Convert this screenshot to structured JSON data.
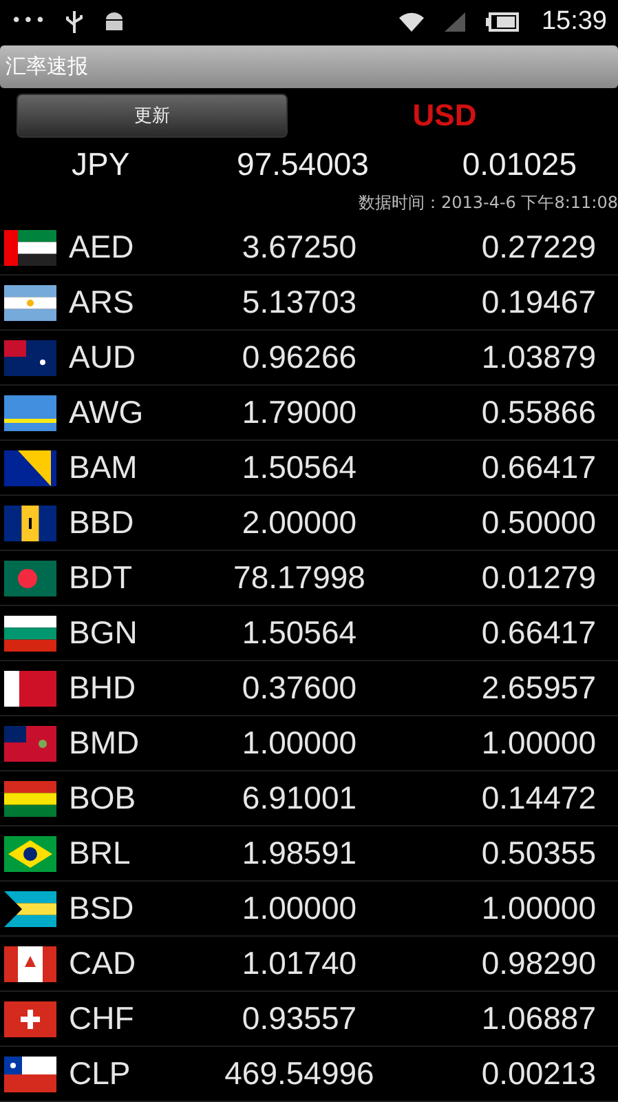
{
  "status_bar": {
    "time": "15:39",
    "notification_dots": "•••"
  },
  "title": "汇率速报",
  "update_button": "更新",
  "base_currency": "USD",
  "featured": {
    "code": "JPY",
    "rate": "97.54003",
    "inverse": "0.01025"
  },
  "data_time": "数据时间：2013-4-6 下午8:11:08",
  "rates": [
    {
      "code": "AED",
      "rate": "3.67250",
      "inverse": "0.27229"
    },
    {
      "code": "ARS",
      "rate": "5.13703",
      "inverse": "0.19467"
    },
    {
      "code": "AUD",
      "rate": "0.96266",
      "inverse": "1.03879"
    },
    {
      "code": "AWG",
      "rate": "1.79000",
      "inverse": "0.55866"
    },
    {
      "code": "BAM",
      "rate": "1.50564",
      "inverse": "0.66417"
    },
    {
      "code": "BBD",
      "rate": "2.00000",
      "inverse": "0.50000"
    },
    {
      "code": "BDT",
      "rate": "78.17998",
      "inverse": "0.01279"
    },
    {
      "code": "BGN",
      "rate": "1.50564",
      "inverse": "0.66417"
    },
    {
      "code": "BHD",
      "rate": "0.37600",
      "inverse": "2.65957"
    },
    {
      "code": "BMD",
      "rate": "1.00000",
      "inverse": "1.00000"
    },
    {
      "code": "BOB",
      "rate": "6.91001",
      "inverse": "0.14472"
    },
    {
      "code": "BRL",
      "rate": "1.98591",
      "inverse": "0.50355"
    },
    {
      "code": "BSD",
      "rate": "1.00000",
      "inverse": "1.00000"
    },
    {
      "code": "CAD",
      "rate": "1.01740",
      "inverse": "0.98290"
    },
    {
      "code": "CHF",
      "rate": "0.93557",
      "inverse": "1.06887"
    },
    {
      "code": "CLP",
      "rate": "469.54996",
      "inverse": "0.00213"
    }
  ]
}
